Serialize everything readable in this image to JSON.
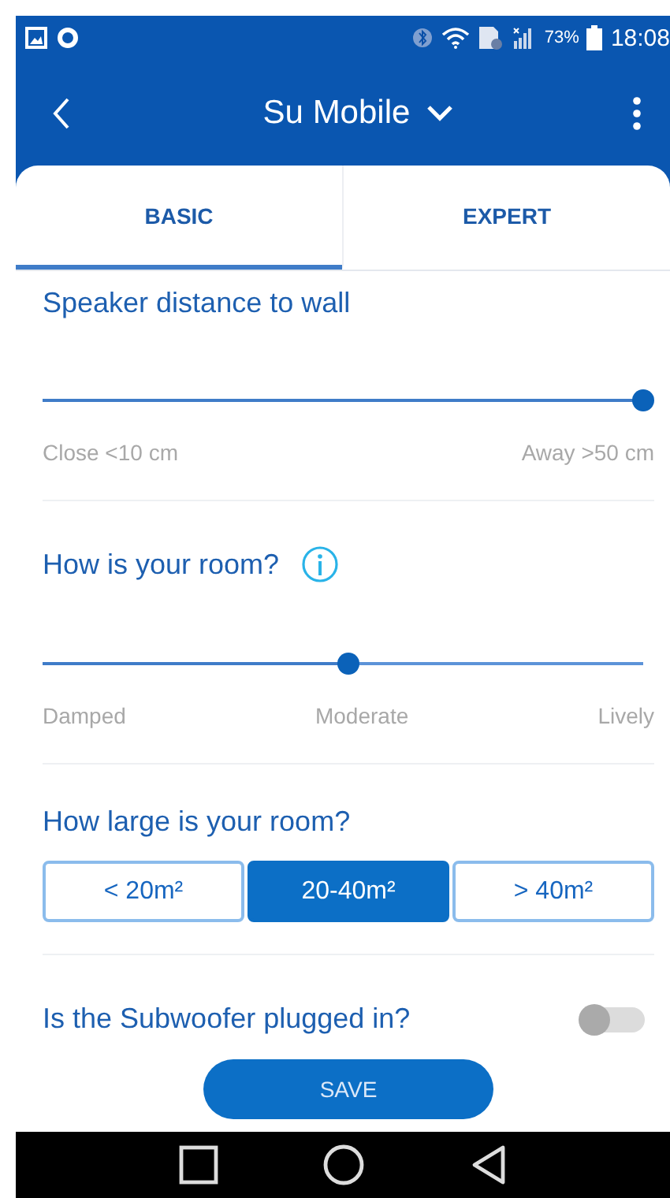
{
  "status_bar": {
    "battery_percent": "73%",
    "time": "18:08"
  },
  "app_bar": {
    "title": "Su Mobile"
  },
  "tabs": [
    {
      "label": "BASIC",
      "selected": true
    },
    {
      "label": "EXPERT",
      "selected": false
    }
  ],
  "sections": [
    {
      "kind": "slider",
      "title": "Speaker distance to wall",
      "level": 1,
      "labels": [
        "Close <10 cm",
        "Away >50 cm"
      ]
    },
    {
      "kind": "slider",
      "title": "How is your room?",
      "info": true,
      "level": 0.5,
      "labels": [
        "Damped",
        "Moderate",
        "Lively"
      ]
    },
    {
      "kind": "choice",
      "title": "How large is your room?",
      "options": [
        {
          "label": "< 20m²",
          "selected": false
        },
        {
          "label": "20-40m²",
          "selected": true
        },
        {
          "label": "> 40m²",
          "selected": false
        }
      ]
    },
    {
      "kind": "switch",
      "title": "Is the Subwoofer plugged in?",
      "on": false
    }
  ],
  "save_button": "SAVE"
}
